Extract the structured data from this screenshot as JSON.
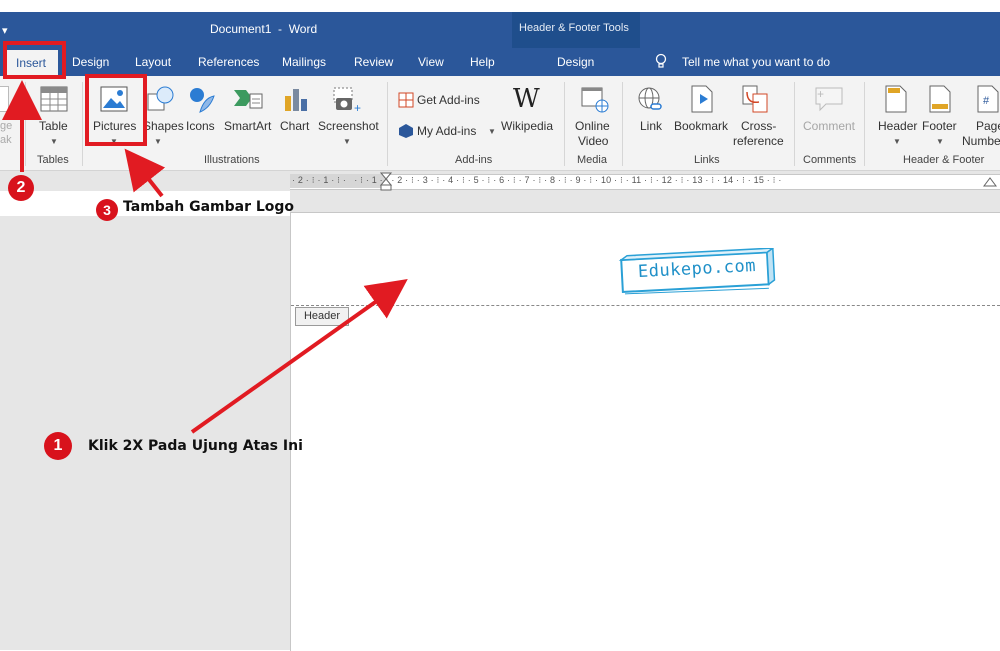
{
  "titlebar": {
    "qat_arrow": "▾",
    "document_title": "Document1  -  Word",
    "contextual_group": "Header & Footer Tools"
  },
  "tabs": {
    "insert": "Insert",
    "design": "Design",
    "layout": "Layout",
    "references": "References",
    "mailings": "Mailings",
    "review": "Review",
    "view": "View",
    "help": "Help",
    "hf_design": "Design",
    "tell_me": "Tell me what you want to do"
  },
  "ribbon": {
    "page_break_partial_1": "ge",
    "page_break_partial_2": "ak",
    "tables": {
      "table": "Table",
      "group": "Tables"
    },
    "illustrations": {
      "pictures": "Pictures",
      "shapes": "Shapes",
      "icons": "Icons",
      "smartart": "SmartArt",
      "chart": "Chart",
      "screenshot": "Screenshot",
      "group": "Illustrations"
    },
    "addins": {
      "get_addins": "Get Add-ins",
      "my_addins": "My Add-ins",
      "wikipedia": "Wikipedia",
      "group": "Add-ins"
    },
    "media": {
      "online_video_1": "Online",
      "online_video_2": "Video",
      "group": "Media"
    },
    "links": {
      "link": "Link",
      "bookmark": "Bookmark",
      "cross_ref_1": "Cross-",
      "cross_ref_2": "reference",
      "group": "Links"
    },
    "comments": {
      "comment": "Comment",
      "group": "Comments"
    },
    "header_footer": {
      "header": "Header",
      "footer": "Footer",
      "page_number_1": "Page",
      "page_number_2": "Numbe",
      "group": "Header & Footer"
    }
  },
  "ruler": {
    "text": "· 2 · ⁝ · 1 · ⁝ ·   · ⁝ · 1 · ⁝ · 2 · ⁝ · 3 · ⁝ · 4 · ⁝ · 5 · ⁝ · 6 · ⁝ · 7 · ⁝ · 8 · ⁝ · 9 · ⁝ · 10 · ⁝ · 11 · ⁝ · 12 · ⁝ · 13 · ⁝ · 14 · ⁝ · 15 · ⁝ ·"
  },
  "document": {
    "header_tag": "Header",
    "logo_text": "Edukepo.com"
  },
  "annotations": {
    "step1_number": "1",
    "step1_text": "Klik 2X Pada Ujung Atas Ini",
    "step2_number": "2",
    "step3_number": "3",
    "step3_text": "Tambah Gambar Logo"
  },
  "colors": {
    "word_blue": "#2b579a",
    "contextual_blue": "#1f4e8c",
    "ribbon_bg": "#f3f3f3",
    "annotation_red": "#e11b22",
    "logo_blue": "#1f90c8"
  }
}
